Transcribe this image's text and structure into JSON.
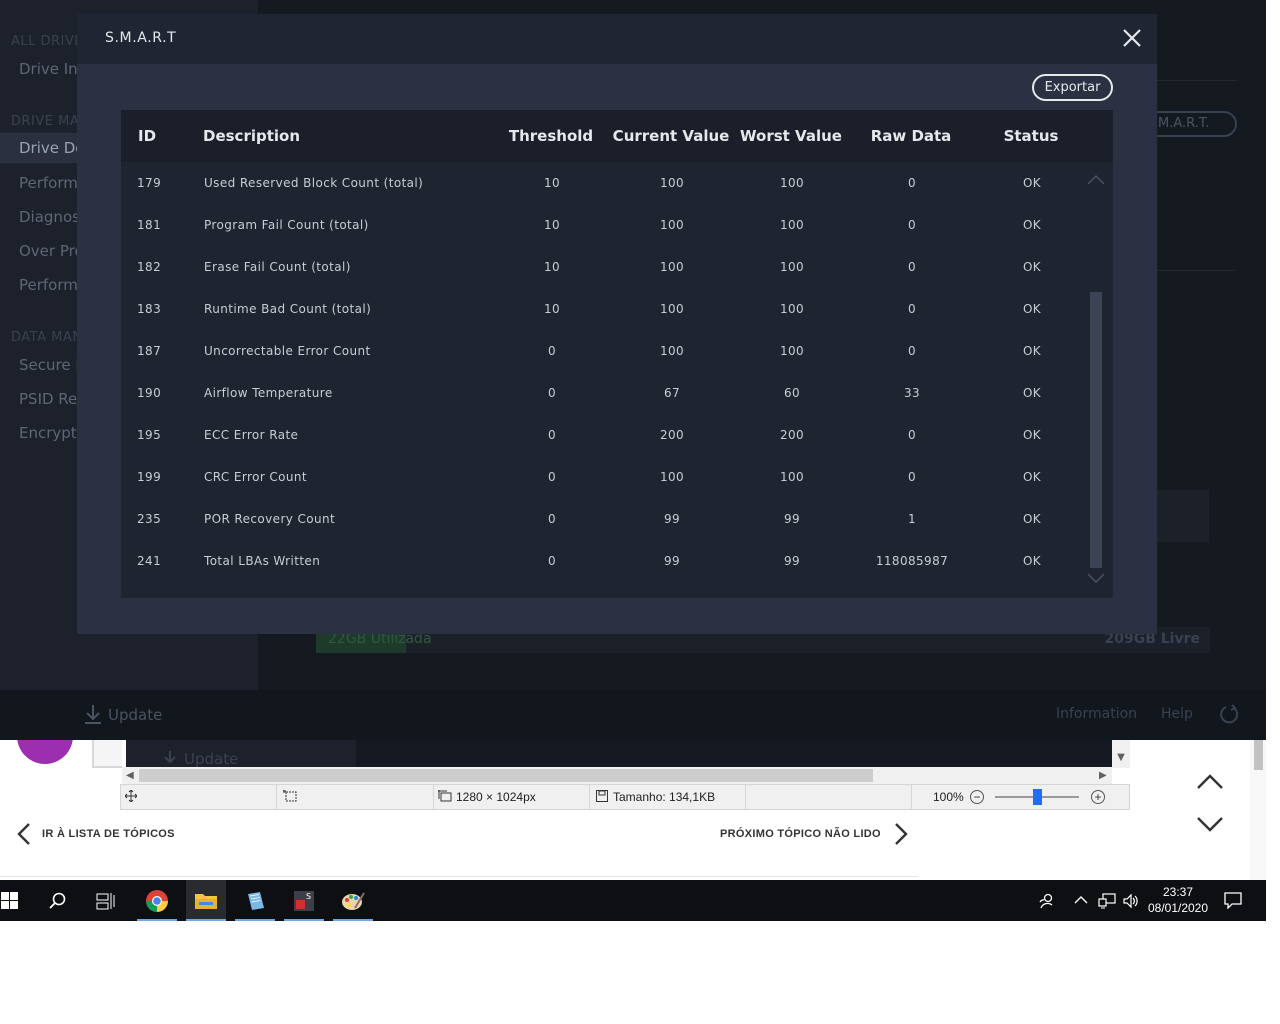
{
  "background_app": {
    "sidebar": {
      "sections": [
        {
          "label": "ALL DRIVE"
        },
        {
          "label": "DRIVE MA"
        },
        {
          "label": "DATA MAN"
        }
      ],
      "items": [
        {
          "label": "Drive Inf"
        },
        {
          "label": "Drive De"
        },
        {
          "label": "Perform"
        },
        {
          "label": "Diagnos"
        },
        {
          "label": "Over Pro"
        },
        {
          "label": "Perform"
        },
        {
          "label": "Secure E"
        },
        {
          "label": "PSID Rev"
        },
        {
          "label": "Encrypte"
        }
      ]
    },
    "smart_button_label": "M.A.R.T.",
    "storage_bar": {
      "used_label": "22GB Utilizada",
      "free_label": "209GB Livre"
    },
    "footer": {
      "update_label": "Update",
      "information_label": "Information",
      "help_label": "Help"
    }
  },
  "modal": {
    "title": "S.M.A.R.T",
    "export_label": "Exportar",
    "columns": [
      "ID",
      "Description",
      "Threshold",
      "Current Value",
      "Worst Value",
      "Raw Data",
      "Status"
    ],
    "rows": [
      {
        "id": "179",
        "description": "Used Reserved Block Count (total)",
        "threshold": "10",
        "current": "100",
        "worst": "100",
        "raw": "0",
        "status": "OK"
      },
      {
        "id": "181",
        "description": "Program Fail Count (total)",
        "threshold": "10",
        "current": "100",
        "worst": "100",
        "raw": "0",
        "status": "OK"
      },
      {
        "id": "182",
        "description": "Erase Fail Count (total)",
        "threshold": "10",
        "current": "100",
        "worst": "100",
        "raw": "0",
        "status": "OK"
      },
      {
        "id": "183",
        "description": "Runtime Bad Count (total)",
        "threshold": "10",
        "current": "100",
        "worst": "100",
        "raw": "0",
        "status": "OK"
      },
      {
        "id": "187",
        "description": "Uncorrectable Error Count",
        "threshold": "0",
        "current": "100",
        "worst": "100",
        "raw": "0",
        "status": "OK"
      },
      {
        "id": "190",
        "description": "Airflow Temperature",
        "threshold": "0",
        "current": "67",
        "worst": "60",
        "raw": "33",
        "status": "OK"
      },
      {
        "id": "195",
        "description": "ECC Error Rate",
        "threshold": "0",
        "current": "200",
        "worst": "200",
        "raw": "0",
        "status": "OK"
      },
      {
        "id": "199",
        "description": "CRC Error Count",
        "threshold": "0",
        "current": "100",
        "worst": "100",
        "raw": "0",
        "status": "OK"
      },
      {
        "id": "235",
        "description": "POR Recovery Count",
        "threshold": "0",
        "current": "99",
        "worst": "99",
        "raw": "1",
        "status": "OK"
      },
      {
        "id": "241",
        "description": "Total LBAs Written",
        "threshold": "0",
        "current": "99",
        "worst": "99",
        "raw": "118085987",
        "status": "OK"
      }
    ]
  },
  "viewer": {
    "strip_update_label": "Update",
    "dimensions": "1280 × 1024px",
    "size": "Tamanho: 134,1KB",
    "zoom": "100%",
    "zoom_level": 0.5
  },
  "forum_nav": {
    "back_label": "IR À LISTA DE TÓPICOS",
    "next_label": "PRÓXIMO TÓPICO NÃO LIDO"
  },
  "taskbar": {
    "time": "23:37",
    "date": "08/01/2020",
    "apps": [
      "start-icon",
      "search-icon",
      "task-view-icon",
      "chrome-icon",
      "file-explorer-icon",
      "notepad-icon",
      "samsung-magician-icon",
      "paint-icon"
    ]
  },
  "colors": {
    "modal_bg": "#2b3142",
    "table_bg": "#1f2431",
    "text": "#e6e8ec",
    "accent_blue": "#1e6ff2"
  }
}
